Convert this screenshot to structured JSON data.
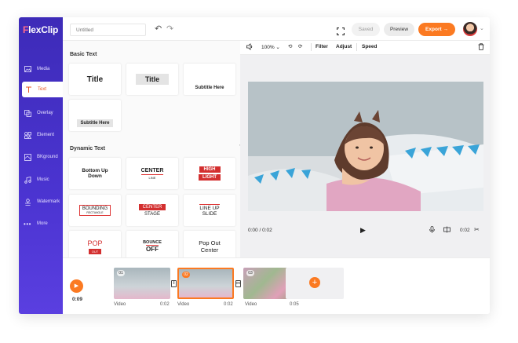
{
  "app": {
    "logo_first": "F",
    "logo_rest": "lexClip"
  },
  "sidebar": {
    "items": [
      {
        "label": "Media",
        "icon": "media-icon"
      },
      {
        "label": "Text",
        "icon": "text-icon"
      },
      {
        "label": "Overlay",
        "icon": "overlay-icon"
      },
      {
        "label": "Element",
        "icon": "element-icon"
      },
      {
        "label": "BKground",
        "icon": "background-icon"
      },
      {
        "label": "Music",
        "icon": "music-icon"
      },
      {
        "label": "Watermark",
        "icon": "watermark-icon"
      },
      {
        "label": "More",
        "icon": "more-icon"
      }
    ],
    "active": "Text"
  },
  "topbar": {
    "title_placeholder": "Untitled",
    "saved": "Saved",
    "preview": "Preview",
    "export": "Export →"
  },
  "panel": {
    "basic_title": "Basic Text",
    "dynamic_title": "Dynamic Text",
    "basic": [
      {
        "l1": "Title"
      },
      {
        "l1": "Title"
      },
      {
        "l1": "Subtitle Here"
      },
      {
        "l1": "Subtitle Here"
      }
    ],
    "dynamic": [
      {
        "l1": "Bottom Up",
        "l2": "Down"
      },
      {
        "l1": "CENTER",
        "l2": "LINE"
      },
      {
        "l1": "HIGH",
        "l2": "LIGHT"
      },
      {
        "l1": "BOUNDING",
        "l2": "RECTANGLE"
      },
      {
        "l1": "CENTER",
        "l2": "STAGE"
      },
      {
        "l1": "LINE UP",
        "l2": "SLIDE"
      },
      {
        "l1": "POP",
        "l2": "OUT"
      },
      {
        "l1": "BOUNCE",
        "l2": "OFF"
      },
      {
        "l1": "Pop Out",
        "l2": "Center"
      }
    ]
  },
  "toolbar": {
    "zoom": "100%",
    "filter": "Filter",
    "adjust": "Adjust",
    "speed": "Speed"
  },
  "player": {
    "current": "0:00 / 0:02",
    "duration": "0:02"
  },
  "timeline": {
    "time": "0:09",
    "clips": [
      {
        "num": "01",
        "label": "Video",
        "dur": "0:02"
      },
      {
        "num": "02",
        "label": "Video",
        "dur": "0:02"
      },
      {
        "num": "03",
        "label": "Video",
        "dur": "0:05"
      }
    ],
    "add": "+"
  },
  "colors": {
    "accent": "#fb7a22",
    "sidebar": "#4b34d1",
    "active_text": "#e8551f"
  }
}
